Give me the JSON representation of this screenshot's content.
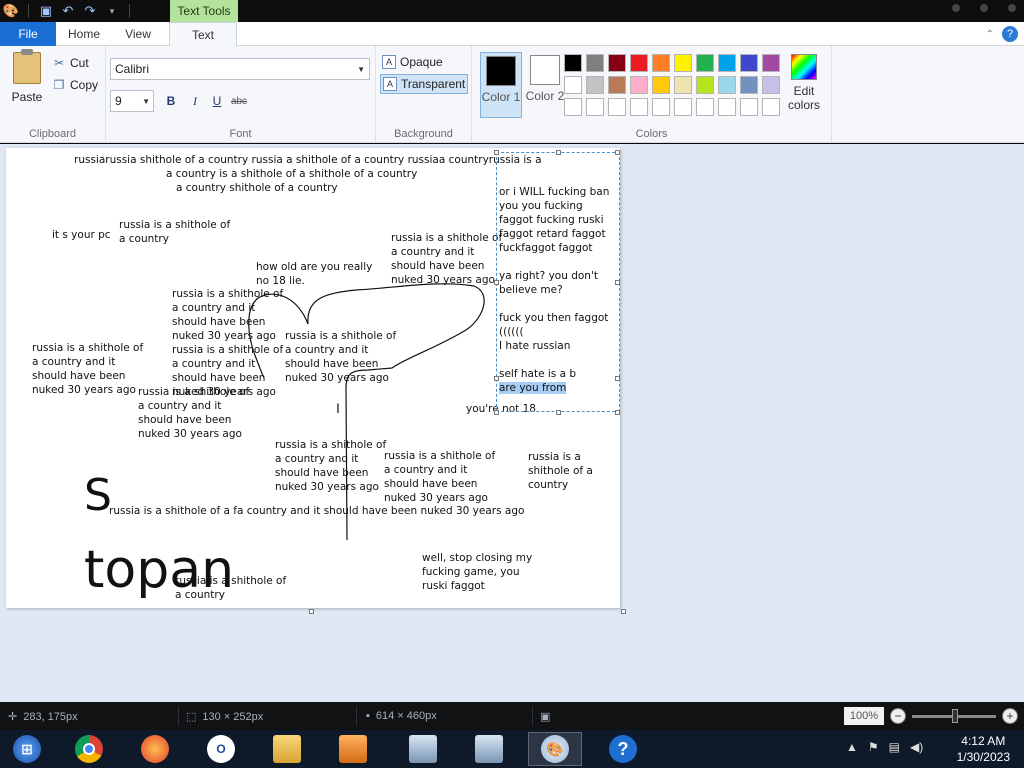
{
  "title_bar": {
    "context_tab": "Text Tools",
    "qat_icons": [
      "paint-app-icon",
      "save-icon",
      "undo-icon",
      "redo-icon",
      "customize-qat-icon"
    ]
  },
  "tabs": {
    "file": "File",
    "home": "Home",
    "view": "View",
    "text": "Text",
    "active": "Text"
  },
  "ribbon": {
    "clipboard": {
      "label": "Clipboard",
      "paste": "Paste",
      "cut": "Cut",
      "copy": "Copy"
    },
    "font": {
      "label": "Font",
      "family": "Calibri",
      "size": "9",
      "bold": "B",
      "italic": "I",
      "underline": "U",
      "strike": "abc"
    },
    "background": {
      "label": "Background",
      "opaque": "Opaque",
      "transparent": "Transparent",
      "selected": "Transparent"
    },
    "colors": {
      "label": "Colors",
      "color1_label": "Color 1",
      "color2_label": "Color 2",
      "color1": "#000000",
      "color2": "#ffffff",
      "edit_colors": "Edit colors",
      "palette": [
        "#000000",
        "#7f7f7f",
        "#880015",
        "#ed1c24",
        "#ff7f27",
        "#fff200",
        "#22b14c",
        "#00a2e8",
        "#3f48cc",
        "#a349a4",
        "#ffffff",
        "#c3c3c3",
        "#b97a57",
        "#ffaec9",
        "#ffc90e",
        "#efe4b0",
        "#b5e61d",
        "#99d9ea",
        "#7092be",
        "#c8bfe7",
        "#ffffff",
        "#ffffff",
        "#ffffff",
        "#ffffff",
        "#ffffff",
        "#ffffff",
        "#ffffff",
        "#ffffff",
        "#ffffff",
        "#ffffff"
      ]
    }
  },
  "canvas": {
    "texts": [
      "russiarussia shithole of a country russia a shithole of a country russiaa countryrussia is a",
      "a country is a shithole of a shithole of a country",
      "a country shithole of a country",
      "it s your pc",
      "russia is a shithole of\na country",
      "how old are you really\nno 18 lie.",
      "russia is a shithole of\na country and it\nshould have been\nnuked 30 years ago",
      "russia is a shithole of\na country and it\nshould have been\nnuked 30 years ago",
      "russia is a shithole of\na country and it\nshould have been\nnuked 30 years ago",
      "russia is a shithole of\na country and it\nshould have been\nnuked 30 years ago",
      "russia is a shithole of\na country and it\nshould have been\nnuked 30 years ago",
      "russia is a shithole of\na country and it\nshould have been\nnuked 30 years ago",
      "russia is a shithole of\na country and it\nshould have been\nnuked 30 years ago",
      "russia is a shithole of\na country and it\nshould have been\nnuked 30 years ago",
      "russia is a\nshithole of a\ncountry",
      "russia is a shithole of a fa country and it should have been nuked 30 years ago",
      "S",
      "topan",
      "russia is a shithole of\na country",
      "well, stop closing my\nfucking game, you\nruski faggot",
      "you're not 18"
    ],
    "selected_text": "or i WILL fucking ban\nyou you fucking\nfaggot fucking ruski\nfaggot retard faggot\nfuckfaggot faggot\n\nya right? you don't\nbelieve me?\n\nfuck you then faggot\n((((((\nI hate russian\n\nself hate is a b",
    "highlighted": "are you from"
  },
  "status": {
    "cursor_pos": "283, 175px",
    "selection_size": "130 × 252px",
    "image_size": "614 × 460px",
    "zoom": "100%"
  },
  "taskbar": {
    "apps": [
      "start-orb-icon",
      "chrome-icon",
      "firefox-icon",
      "opera-icon",
      "file-explorer-icon",
      "unknown-app-icon",
      "remote-desktop-icon",
      "remote-desktop-icon",
      "paint-icon",
      "help-icon"
    ],
    "time": "4:12 AM",
    "date": "1/30/2023"
  }
}
